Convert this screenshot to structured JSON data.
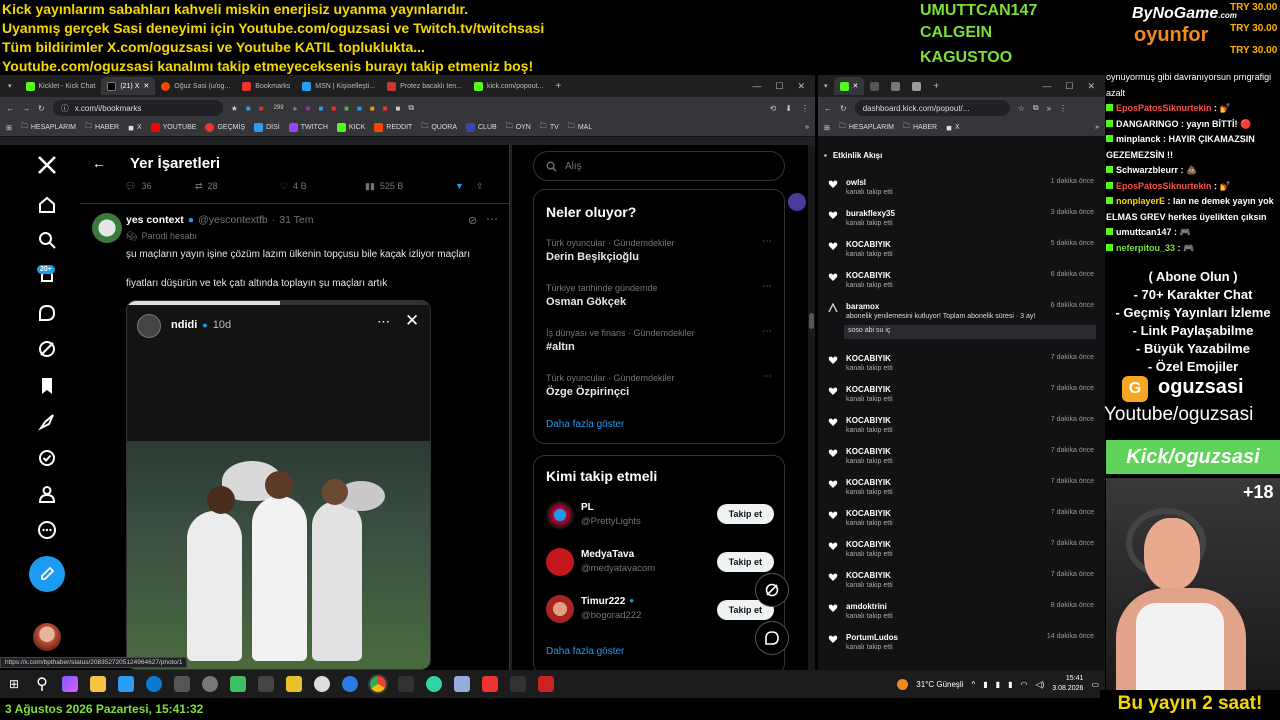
{
  "overlay": {
    "lines": [
      "Kick yayınlarım sabahları kahveli miskin enerjisiz uyanma yayınlarıdır.",
      "Uyanmış gerçek Sasi deneyimi için Youtube.com/oguzsasi ve Twitch.tv/twitchsasi",
      "Tüm bildirimler X.com/oguzsasi ve Youtube KATIL topluklukta...",
      "Youtube.com/oguzsasi kanalımı takip etmeyeceksenis burayı takip etmeniz boş!"
    ],
    "donors": [
      "UMUTTCAN147",
      "CALGEIN",
      "KAGUSTOO"
    ],
    "brand_top": "ByNoGame",
    "brand_top_small": ".com",
    "brand_bottom": "oyunfor",
    "amounts": [
      "TRY 30.00",
      "TRY 30.00",
      "TRY 30.00"
    ],
    "bottom_left": "3 Ağustos 2026 Pazartesi, 15:41:32",
    "bottom_right": "Bu yayın 2 saat!",
    "cam_badge": "+18"
  },
  "browser_left": {
    "tabs": [
      "Kicklet - Kick Chat",
      "(21) X",
      "Oğuz Sasi (u/og...",
      "Bookmarks",
      "MSN | Kişiselleşti...",
      "Protez bacaklı ten...",
      "kick.com/popout..."
    ],
    "url": "x.com/i/bookmarks",
    "badge": "299",
    "bookmarks": [
      "HESAPLARIM",
      "HABER",
      "X",
      "YOUTUBE",
      "GEÇMİŞ",
      "DİSİ",
      "TWITCH",
      "KICK",
      "REDDIT",
      "QUORA",
      "CLUB",
      "OYN",
      "TV",
      "MAL"
    ],
    "status_url": "https://x.com/bpthaber/status/2083527205124964627/photo/1"
  },
  "x": {
    "header": "Yer İşaretleri",
    "prev_stats": {
      "replies": "36",
      "reposts": "28",
      "likes": "4 B",
      "views": "525 B"
    },
    "tweet": {
      "name": "yes context",
      "handle": "@yescontextfb",
      "time": "31 Tem",
      "parody": "Parodi hesabı",
      "text1": "şu maçların yayın işine çözüm lazım ülkenin topçusu bile kaçak izliyor maçları",
      "text2": "fiyatları düşürün ve tek çatı altında toplayın şu maçları artık"
    },
    "story": {
      "user": "ndidi",
      "time": "10d"
    },
    "notif_badge": "20+",
    "search_placeholder": "Alış",
    "whats_happening": "Neler oluyor?",
    "trends": [
      {
        "meta": "Türk oyuncular · Gündemdekiler",
        "name": "Derin Beşikçioğlu"
      },
      {
        "meta": "Türkiye tarihinde gündemde",
        "name": "Osman Gökçek"
      },
      {
        "meta": "İş dünyası ve finans · Gündemdekiler",
        "name": "#altın"
      },
      {
        "meta": "Türk oyuncular · Gündemdekiler",
        "name": "Özge Özpirinçci"
      }
    ],
    "show_more": "Daha fazla göster",
    "who_to_follow": "Kimi takip etmeli",
    "follow_label": "Takip et",
    "suggestions": [
      {
        "name": "PL",
        "handle": "@PrettyLights"
      },
      {
        "name": "MedyaTava",
        "handle": "@medyatavacom"
      },
      {
        "name": "Timur222",
        "handle": "@bogorad222"
      }
    ]
  },
  "kick": {
    "url": "dashboard.kick.com/popout/...",
    "bookmarks": [
      "HESAPLARIM",
      "HABER",
      "X"
    ],
    "title": "Etkinlik Akışı",
    "events": [
      {
        "name": "owlsl",
        "sub": "kanalı takip etti",
        "time": "1 dakika önce"
      },
      {
        "name": "burakflexy35",
        "sub": "kanalı takip etti",
        "time": "3 dakika önce"
      },
      {
        "name": "KOCABIYIK",
        "sub": "kanalı takip etti",
        "time": "5 dakika önce"
      },
      {
        "name": "KOCABIYIK",
        "sub": "kanalı takip etti",
        "time": "6 dakika önce"
      },
      {
        "name": "baramox",
        "sub": "abonelik yenilemesini kutluyor! Toplam abonelik süresi · 3 ay!",
        "time": "6 dakika önce",
        "msg": "soso abi su iç"
      },
      {
        "name": "KOCABIYIK",
        "sub": "kanalı takip etti",
        "time": "7 dakika önce"
      },
      {
        "name": "KOCABIYIK",
        "sub": "kanalı takip etti",
        "time": "7 dakika önce"
      },
      {
        "name": "KOCABIYIK",
        "sub": "kanalı takip etti",
        "time": "7 dakika önce"
      },
      {
        "name": "KOCABIYIK",
        "sub": "kanalı takip etti",
        "time": "7 dakika önce"
      },
      {
        "name": "KOCABIYIK",
        "sub": "kanalı takip etti",
        "time": "7 dakika önce"
      },
      {
        "name": "KOCABIYIK",
        "sub": "kanalı takip etti",
        "time": "7 dakika önce"
      },
      {
        "name": "KOCABIYIK",
        "sub": "kanalı takip etti",
        "time": "7 dakika önce"
      },
      {
        "name": "KOCABIYIK",
        "sub": "kanalı takip etti",
        "time": "7 dakika önce"
      },
      {
        "name": "amdoktrini",
        "sub": "kanalı takip etti",
        "time": "8 dakika önce"
      },
      {
        "name": "PortumLudos",
        "sub": "kanalı takip etti",
        "time": "14 dakika önce"
      }
    ]
  },
  "chat": [
    {
      "user": "",
      "text": "oynuyormuş gibi davranıyorsun prngrafigi azalt",
      "color": "#ffffff"
    },
    {
      "user": "EposPatosSiknurtekin",
      "text": ": 💅",
      "color": "#ff4d4d"
    },
    {
      "user": "DANGARINGO",
      "text": ": yayın BİTTİ! 🔴",
      "color": "#ffffff"
    },
    {
      "user": "minplanck",
      "text": ": HAYIR ÇIKAMAZSIN GEZEMEZSİN !!",
      "color": "#ffffff"
    },
    {
      "user": "Schwarzbleurr",
      "text": ": 💩",
      "color": "#ffffff"
    },
    {
      "user": "EposPatosSiknurtekin",
      "text": ": 💅",
      "color": "#ff4d4d"
    },
    {
      "user": "nonplayerE",
      "text": ": lan ne demek yayın yok ELMAS GREV herkes üyelikten çıksın",
      "color": "#ffd600"
    },
    {
      "user": "umuttcan147",
      "text": ": 🎮",
      "color": "#ffffff"
    },
    {
      "user": "neferpitou_33",
      "text": ": 🎮",
      "color": "#7ddf3a"
    }
  ],
  "promo": [
    "( Abone Olun )",
    "- 70+ Karakter Chat",
    "- Geçmiş Yayınları İzleme",
    "- Link Paylaşabilme",
    "- Büyük Yazabilme",
    "- Özel Emojiler"
  ],
  "channel": {
    "name": "oguzsasi",
    "yt": "Youtube/oguzsasi",
    "kick": "Kick/oguzsasi"
  },
  "taskbar": {
    "weather": "31°C  Güneşli",
    "time": "15:41",
    "date": "3.08.2026"
  },
  "colors": {
    "overlay_yellow": "#f5d800",
    "donor_green": "#7ddf3a",
    "x_blue": "#1d9bf0",
    "kick_green": "#53fc18",
    "promo_green": "#5fd35a"
  }
}
